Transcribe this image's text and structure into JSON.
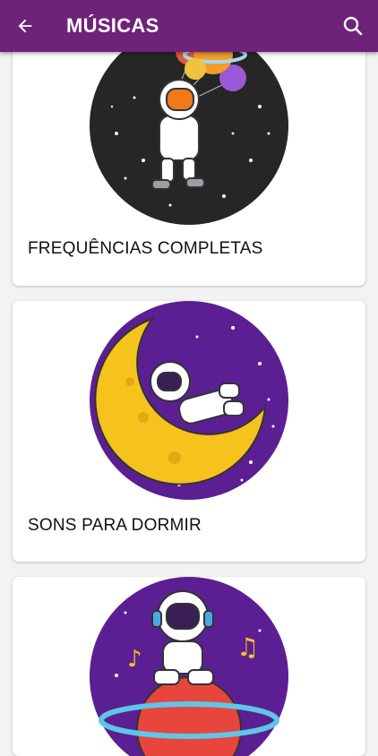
{
  "app_bar": {
    "title": "MÚSICAS",
    "back_icon": "arrow-left-icon",
    "search_icon": "search-icon",
    "background": "#6f2279"
  },
  "categories": [
    {
      "label": "FREQUÊNCIAS COMPLETAS",
      "image": "astronaut-planet-balloons-illustration",
      "circle_color": "#262626"
    },
    {
      "label": "SONS PARA DORMIR",
      "image": "astronaut-sleeping-on-moon-illustration",
      "circle_color": "#5b1f93"
    },
    {
      "label": "",
      "image": "astronaut-with-headphones-on-planet-illustration",
      "circle_color": "#5b1f93"
    }
  ]
}
